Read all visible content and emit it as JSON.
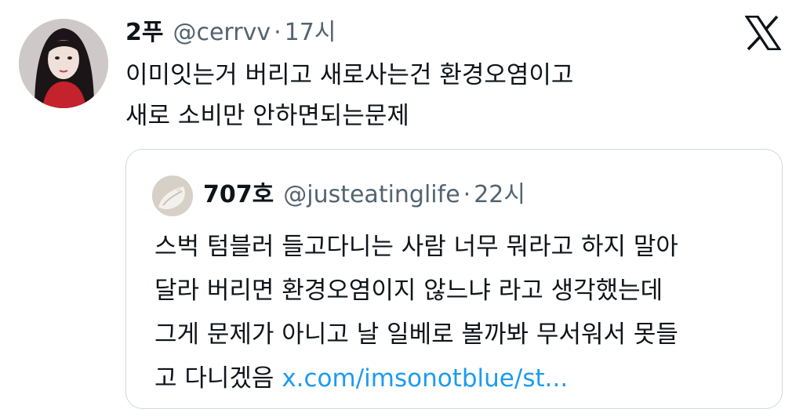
{
  "tweet": {
    "author": {
      "display_name": "2푸",
      "handle": "@cerrvv",
      "separator": "·",
      "time": "17시"
    },
    "text_lines": [
      "이미잇는거 버리고 새로사는건 환경오염이고",
      "새로 소비만 안하면되는문제"
    ],
    "logo_icon": "x-logo-icon"
  },
  "quoted_tweet": {
    "author": {
      "display_name": "707호",
      "handle": "@justeatinglife",
      "separator": "·",
      "time": "22시"
    },
    "text_lines": [
      "스벅 텀블러 들고다니는 사람 너무 뭐라고 하지 말아",
      "달라 버리면 환경오염이지 않느냐 라고 생각했는데",
      "그게 문제가 아니고 날 일베로 볼까봐 무서워서 못들"
    ],
    "last_line_text": "고 다니겠음 ",
    "link_text": "x.com/imsonotblue/st..."
  },
  "colors": {
    "text": "#0f1419",
    "secondary": "#536471",
    "link": "#1d9bf0",
    "border": "#cfd9de"
  }
}
